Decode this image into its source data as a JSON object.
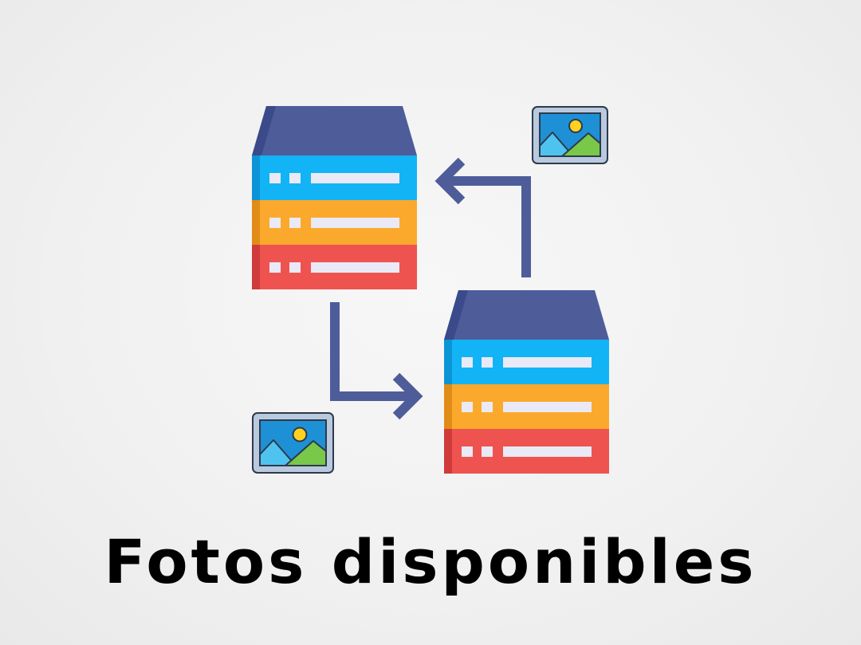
{
  "caption": "Fotos disponibles",
  "icons": {
    "source_server": "server-stack-icon",
    "target_server": "server-stack-icon",
    "transfer_arrow_down_right": "arrow-elbow-right-icon",
    "transfer_arrow_up_left": "arrow-elbow-left-icon",
    "photo_top": "image-icon",
    "photo_bottom": "image-icon"
  },
  "colors": {
    "server_top": "#4E5D99",
    "server_top_side": "#3A4A8A",
    "tier_blue": "#12B4F6",
    "tier_blue_shade": "#0B95D6",
    "tier_orange": "#FBA92C",
    "tier_orange_shade": "#E08C16",
    "tier_red": "#EF5350",
    "tier_red_shade": "#CF3A3A",
    "slot": "#E9EAF6",
    "arrow": "#4E5D99",
    "photo_frame": "#B9C9DE",
    "photo_sky": "#1E90D6",
    "photo_sun": "#FFD21F",
    "photo_hill_green": "#79C84A",
    "photo_hill_blue": "#4FC3F0",
    "outline": "#2E3A4B"
  }
}
